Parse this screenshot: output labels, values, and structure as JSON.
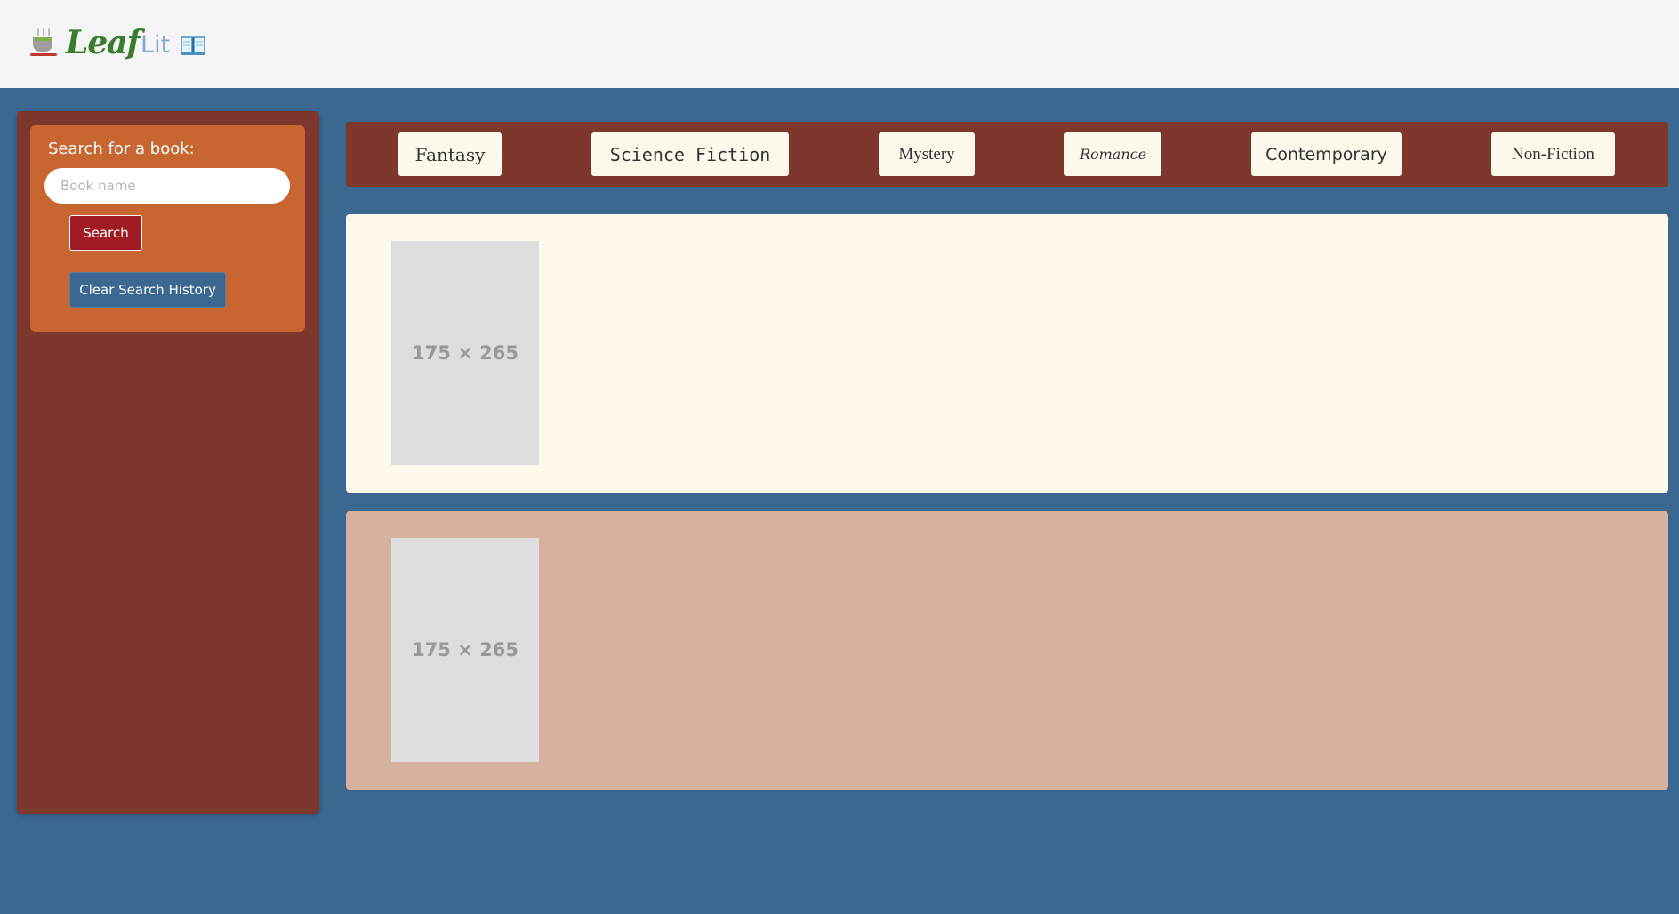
{
  "header": {
    "brand_leaf": "Leaf",
    "brand_lit": "Lit",
    "icons": [
      "teacup-icon",
      "open-book-icon"
    ]
  },
  "sidebar": {
    "search_label": "Search for a book:",
    "search_placeholder": "Book name",
    "search_value": "",
    "search_button": "Search",
    "clear_button": "Clear Search History"
  },
  "genres": [
    {
      "label": "Fantasy"
    },
    {
      "label": "Science Fiction"
    },
    {
      "label": "Mystery"
    },
    {
      "label": "Romance"
    },
    {
      "label": "Contemporary"
    },
    {
      "label": "Non-Fiction"
    }
  ],
  "results": [
    {
      "image_placeholder": "175 × 265"
    },
    {
      "image_placeholder": "175 × 265"
    }
  ],
  "colors": {
    "page_background": "#3b6890",
    "header_background": "#f5f5f5",
    "sidebar_background": "#7e372c",
    "search_card_background": "#c86631",
    "search_button": "#a01b24",
    "clear_button": "#3b6890",
    "genre_bar": "#7e372c",
    "genre_button": "#fdf8ec",
    "result_panel_1": "#fef9ec",
    "result_panel_2": "#d6b1a0",
    "brand_leaf": "#3a7d2e",
    "brand_lit": "#7fa8d6"
  }
}
